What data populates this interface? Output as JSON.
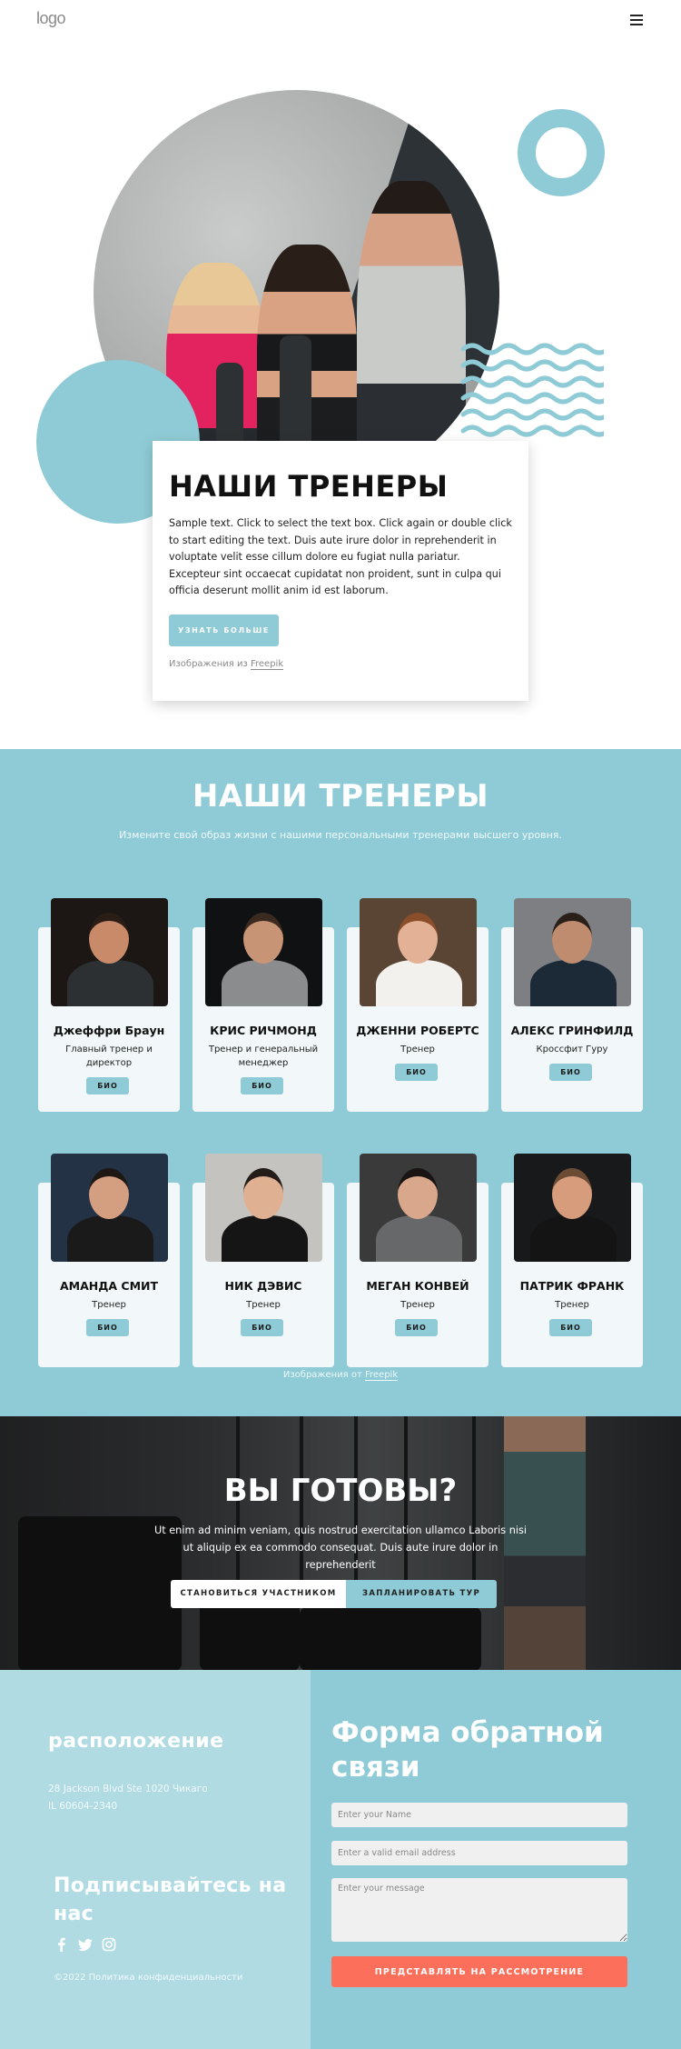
{
  "header": {
    "logo": "logo",
    "menu_icon": "hamburger-menu-icon"
  },
  "hero": {
    "title": "НАШИ ТРЕНЕРЫ",
    "text": "Sample text. Click to select the text box. Click again or double click to start editing the text. Duis aute irure dolor in reprehenderit in voluptate velit esse cillum dolore eu fugiat nulla pariatur. Excepteur sint occaecat cupidatat non proident, sunt in culpa qui officia deserunt mollit anim id est laborum.",
    "button_label": "УЗНАТЬ БОЛЬШЕ",
    "credit_prefix": "Изображения из",
    "credit_link": "Freepik"
  },
  "trainers": {
    "title": "НАШИ ТРЕНЕРЫ",
    "subtitle": "Измените свой образ жизни с нашими персональными тренерами высшего уровня.",
    "bio_label": "БИО",
    "items": [
      {
        "name": "Джеффри Браун",
        "role": "Главный тренер и директор"
      },
      {
        "name": "КРИС РИЧМОНД",
        "role": "Тренер и генеральный менеджер"
      },
      {
        "name": "ДЖЕННИ РОБЕРТС",
        "role": "Тренер"
      },
      {
        "name": "АЛЕКС ГРИНФИЛД",
        "role": "Кроссфит Гуру"
      },
      {
        "name": "АМАНДА СМИТ",
        "role": "Тренер"
      },
      {
        "name": "НИК ДЭВИС",
        "role": "Тренер"
      },
      {
        "name": "МЕГАН КОНВЕЙ",
        "role": "Тренер"
      },
      {
        "name": "ПАТРИК ФРАНК",
        "role": "Тренер"
      }
    ],
    "credit_prefix": "Изображения от",
    "credit_link": "Freepik"
  },
  "cta": {
    "title": "ВЫ ГОТОВЫ?",
    "text": "Ut enim ad minim veniam, quis nostrud exercitation ullamco Laboris nisi ut aliquip ex ea commodo consequat. Duis aute irure dolor in reprehenderit",
    "primary_label": "СТАНОВИТЬСЯ УЧАСТНИКОМ",
    "secondary_label": "ЗАПЛАНИРОВАТЬ ТУР"
  },
  "footer": {
    "location_title": "расположение",
    "address_line1": "28 Jackson Blvd Ste 1020 Чикаго",
    "address_line2": "IL 60604-2340",
    "subscribe_title": "Подписывайтесь на нас",
    "socials": [
      "facebook-icon",
      "twitter-icon",
      "instagram-icon"
    ],
    "copyright": "©2022 Политика конфиденциальности"
  },
  "form": {
    "title": "Форма обратной связи",
    "name_placeholder": "Enter your Name",
    "email_placeholder": "Enter a valid email address",
    "message_placeholder": "Enter your message",
    "submit_label": "ПРЕДСТАВЛЯТЬ НА РАССМОТРЕНИЕ"
  },
  "colors": {
    "accent": "#8fcbd6",
    "footer_left": "#b0dbe3",
    "submit": "#fc6f5a"
  }
}
